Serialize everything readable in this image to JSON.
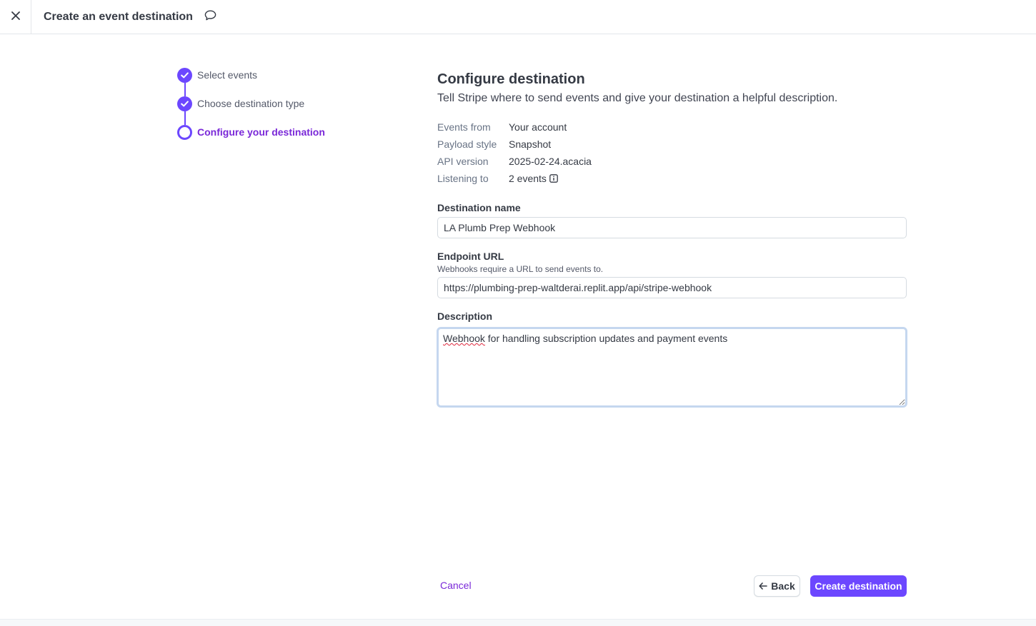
{
  "header": {
    "title": "Create an event destination",
    "close_icon": "close-icon",
    "feedback_icon": "chat-bubble-icon"
  },
  "stepper": {
    "steps": [
      {
        "label": "Select events",
        "status": "complete"
      },
      {
        "label": "Choose destination type",
        "status": "complete"
      },
      {
        "label": "Configure your destination",
        "status": "current"
      }
    ]
  },
  "main": {
    "title": "Configure destination",
    "subtitle": "Tell Stripe where to send events and give your destination a helpful description.",
    "meta": [
      {
        "key": "Events from",
        "value": "Your account"
      },
      {
        "key": "Payload style",
        "value": "Snapshot"
      },
      {
        "key": "API version",
        "value": "2025-02-24.acacia"
      },
      {
        "key": "Listening to",
        "value": "2 events"
      }
    ],
    "destination_name": {
      "label": "Destination name",
      "value": "LA Plumb Prep Webhook"
    },
    "endpoint_url": {
      "label": "Endpoint URL",
      "help": "Webhooks require a URL to send events to.",
      "value": "https://plumbing-prep-waltderai.replit.app/api/stripe-webhook"
    },
    "description": {
      "label": "Description",
      "value_first_word": "Webhook",
      "value_rest": " for handling subscription updates and payment events"
    }
  },
  "footer": {
    "cancel_label": "Cancel",
    "back_label": "Back",
    "create_label": "Create destination"
  },
  "colors": {
    "accent": "#6c47ff",
    "link": "#7a28d8",
    "focus_ring": "#c5d7ef"
  }
}
